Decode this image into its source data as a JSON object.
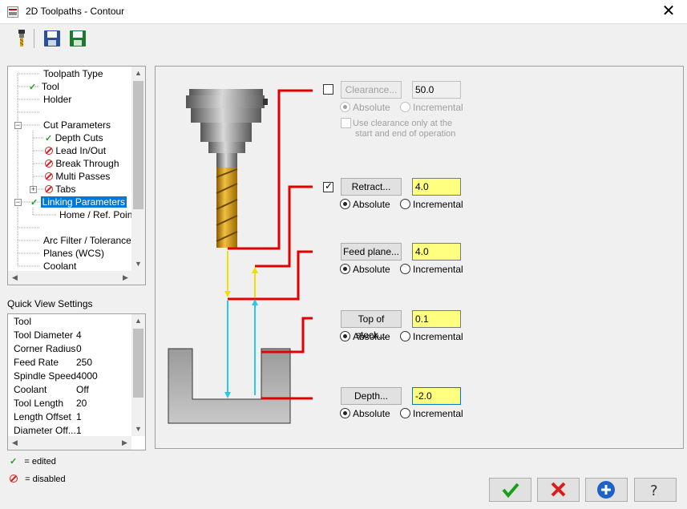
{
  "window": {
    "title": "2D Toolpaths - Contour",
    "close_glyph": "✕"
  },
  "toolbar": {
    "icons": [
      "tool-icon",
      "save-icon",
      "save-as-icon"
    ]
  },
  "tree": {
    "items": [
      {
        "label": "Toolpath Type",
        "status": "none"
      },
      {
        "label": "Tool",
        "status": "edited"
      },
      {
        "label": "Holder",
        "status": "none"
      },
      {
        "label": "",
        "status": "none"
      },
      {
        "label": "Cut Parameters",
        "status": "none"
      },
      {
        "label": "Depth Cuts",
        "status": "edited"
      },
      {
        "label": "Lead In/Out",
        "status": "disabled"
      },
      {
        "label": "Break Through",
        "status": "disabled"
      },
      {
        "label": "Multi Passes",
        "status": "disabled"
      },
      {
        "label": "Tabs",
        "status": "disabled"
      },
      {
        "label": "Linking Parameters",
        "status": "edited",
        "selected": true
      },
      {
        "label": "Home / Ref. Points",
        "status": "none"
      },
      {
        "label": "",
        "status": "none"
      },
      {
        "label": "Arc Filter / Tolerance",
        "status": "none"
      },
      {
        "label": "Planes (WCS)",
        "status": "none"
      },
      {
        "label": "Coolant",
        "status": "none"
      }
    ]
  },
  "quick_view": {
    "title": "Quick View Settings",
    "rows": [
      {
        "label": "Tool",
        "value": ""
      },
      {
        "label": "Tool Diameter",
        "value": "4"
      },
      {
        "label": "Corner Radius",
        "value": "0"
      },
      {
        "label": "Feed Rate",
        "value": "250"
      },
      {
        "label": "Spindle Speed",
        "value": "4000"
      },
      {
        "label": "Coolant",
        "value": "Off"
      },
      {
        "label": "Tool Length",
        "value": "20"
      },
      {
        "label": "Length Offset",
        "value": "1"
      },
      {
        "label": "Diameter Off...",
        "value": "1"
      }
    ]
  },
  "legend": {
    "edited": "= edited",
    "disabled": "= disabled"
  },
  "params": {
    "clearance": {
      "label": "Clearance...",
      "value": "50.0",
      "checked": false,
      "absolute": "Absolute",
      "incremental": "Incremental",
      "note": "Use clearance only at the",
      "note2": "start and end of operation"
    },
    "retract": {
      "label": "Retract...",
      "value": "4.0",
      "checked": true,
      "absolute": "Absolute",
      "incremental": "Incremental"
    },
    "feed_plane": {
      "label": "Feed plane...",
      "value": "4.0",
      "absolute": "Absolute",
      "incremental": "Incremental"
    },
    "top_of_stock": {
      "label": "Top of stock...",
      "value": "0.1",
      "absolute": "Absolute",
      "incremental": "Incremental"
    },
    "depth": {
      "label": "Depth...",
      "value": "-2.0",
      "absolute": "Absolute",
      "incremental": "Incremental"
    }
  },
  "colors": {
    "accent_red": "#e00000",
    "yellow_arrow": "#f0e000",
    "cyan_arrow": "#29c7e8",
    "field_yellow": "#ffff80",
    "selection_blue": "#0078d7"
  },
  "footer": {
    "buttons": [
      "ok-icon",
      "cancel-icon",
      "add-icon",
      "help-icon"
    ]
  }
}
